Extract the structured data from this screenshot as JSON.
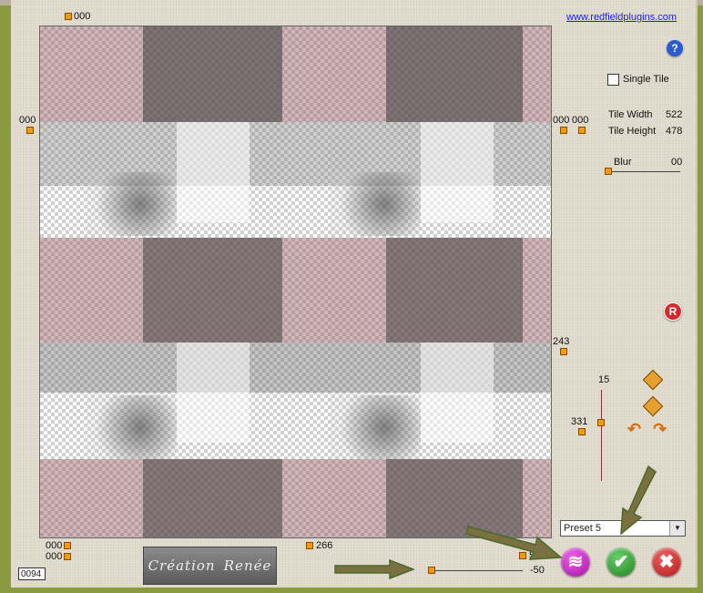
{
  "link": {
    "text": "www.redfieldplugins.com"
  },
  "preview": {
    "top_value": "000",
    "left_value": "000",
    "right_value_a": "000",
    "right_value_b": "000",
    "right_mid_value": "243",
    "bottom_left_a": "000",
    "bottom_left_b": "000",
    "bottom_mid": "266",
    "bottom_right": "500"
  },
  "controls": {
    "single_tile_label": "Single Tile",
    "tile_width_label": "Tile Width",
    "tile_width_value": "522",
    "tile_height_label": "Tile Height",
    "tile_height_value": "478",
    "blur_label": "Blur",
    "blur_value": "00",
    "vertical_top_value": "15",
    "vertical_left_value": "331",
    "bottom_slider_value": "-50",
    "preset_value": "Preset 5"
  },
  "counter": "0094",
  "logo": {
    "word1": "Création",
    "word2": "Renée"
  },
  "icons": {
    "help": "question-icon",
    "reset": "R",
    "random": "dice-icon",
    "ok": "checkmark-icon",
    "cancel": "close-icon"
  },
  "colors": {
    "handle": "#f29a10",
    "ok_green": "#2e9e2e",
    "cancel_red": "#d42a2a",
    "random_purple": "#c020c0",
    "annotation_arrow": "#7a7040"
  }
}
